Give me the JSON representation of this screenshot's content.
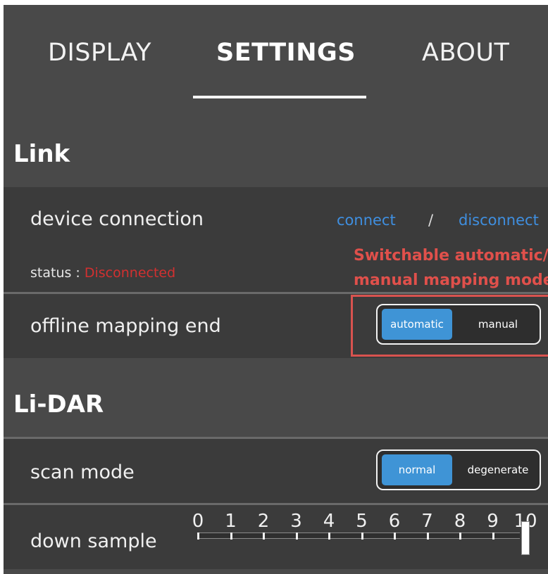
{
  "tabs": [
    {
      "label": "DISPLAY",
      "active": false
    },
    {
      "label": "SETTINGS",
      "active": true
    },
    {
      "label": "ABOUT",
      "active": false
    }
  ],
  "link_section": {
    "title": "Link",
    "device_connection": {
      "label": "device connection",
      "connect_label": "connect",
      "separator": "/",
      "disconnect_label": "disconnect",
      "status_label": "status :",
      "status_value": "Disconnected"
    },
    "offline_mapping_end": {
      "label": "offline mapping end",
      "options": [
        "automatic",
        "manual"
      ],
      "selected": "automatic"
    }
  },
  "annotation": {
    "line1": "Switchable automatic/",
    "line2": "manual mapping mode"
  },
  "lidar_section": {
    "title": "Li-DAR",
    "scan_mode": {
      "label": "scan mode",
      "options": [
        "normal",
        "degenerate"
      ],
      "selected": "normal"
    },
    "down_sample": {
      "label": "down sample",
      "ticks": [
        "0",
        "1",
        "2",
        "3",
        "4",
        "5",
        "6",
        "7",
        "8",
        "9",
        "10"
      ],
      "value": 10
    }
  },
  "colors": {
    "background": "#494949",
    "row_background": "#3b3b3b",
    "accent": "#3f94d6",
    "link": "#3f8fe0",
    "status_error": "#d23030",
    "annotation": "#e0504b"
  }
}
